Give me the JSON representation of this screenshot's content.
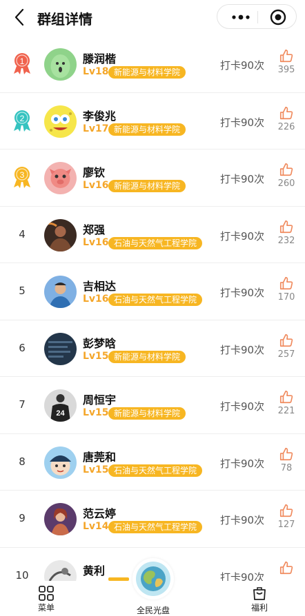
{
  "header": {
    "title": "群组详情"
  },
  "colors": {
    "accent": "#f7b622",
    "like": "#f08a5d",
    "level": "#f4a62a"
  },
  "members": [
    {
      "rank": "1",
      "medal": "red",
      "name": "滕润楷",
      "level": "Lv18",
      "college": "新能源与材料学院",
      "checkin": "打卡90次",
      "likes": "395",
      "avatar": "green-character"
    },
    {
      "rank": "2",
      "medal": "teal",
      "name": "李俊兆",
      "level": "Lv17",
      "college": "新能源与材料学院",
      "checkin": "打卡90次",
      "likes": "226",
      "avatar": "sponge-character"
    },
    {
      "rank": "3",
      "medal": "gold",
      "name": "廖钦",
      "level": "Lv16",
      "college": "新能源与材料学院",
      "checkin": "打卡90次",
      "likes": "260",
      "avatar": "pink-animal"
    },
    {
      "rank": "4",
      "medal": "",
      "name": "郑强",
      "level": "Lv16",
      "college": "石油与天然气工程学院",
      "checkin": "打卡90次",
      "likes": "232",
      "avatar": "dark-photo"
    },
    {
      "rank": "5",
      "medal": "",
      "name": "吉相达",
      "level": "Lv16",
      "college": "石油与天然气工程学院",
      "checkin": "打卡90次",
      "likes": "170",
      "avatar": "blue-photo"
    },
    {
      "rank": "6",
      "medal": "",
      "name": "彭梦晗",
      "level": "Lv15",
      "college": "新能源与材料学院",
      "checkin": "打卡90次",
      "likes": "257",
      "avatar": "screen-photo"
    },
    {
      "rank": "7",
      "medal": "",
      "name": "周恒宇",
      "level": "Lv15",
      "college": "新能源与材料学院",
      "checkin": "打卡90次",
      "likes": "221",
      "avatar": "jersey-24"
    },
    {
      "rank": "8",
      "medal": "",
      "name": "唐莞和",
      "level": "Lv15",
      "college": "石油与天然气工程学院",
      "checkin": "打卡90次",
      "likes": "78",
      "avatar": "cartoon-kid"
    },
    {
      "rank": "9",
      "medal": "",
      "name": "范云婷",
      "level": "Lv14",
      "college": "石油与天然气工程学院",
      "checkin": "打卡90次",
      "likes": "127",
      "avatar": "girl-drawing"
    },
    {
      "rank": "10",
      "medal": "",
      "name": "黄利",
      "level": "",
      "college": "",
      "checkin": "打卡90次",
      "likes": "",
      "avatar": "sketch"
    }
  ],
  "tabbar": {
    "menu": "菜单",
    "center": "全民光盘",
    "welfare": "福利"
  },
  "avatar_number": "24"
}
